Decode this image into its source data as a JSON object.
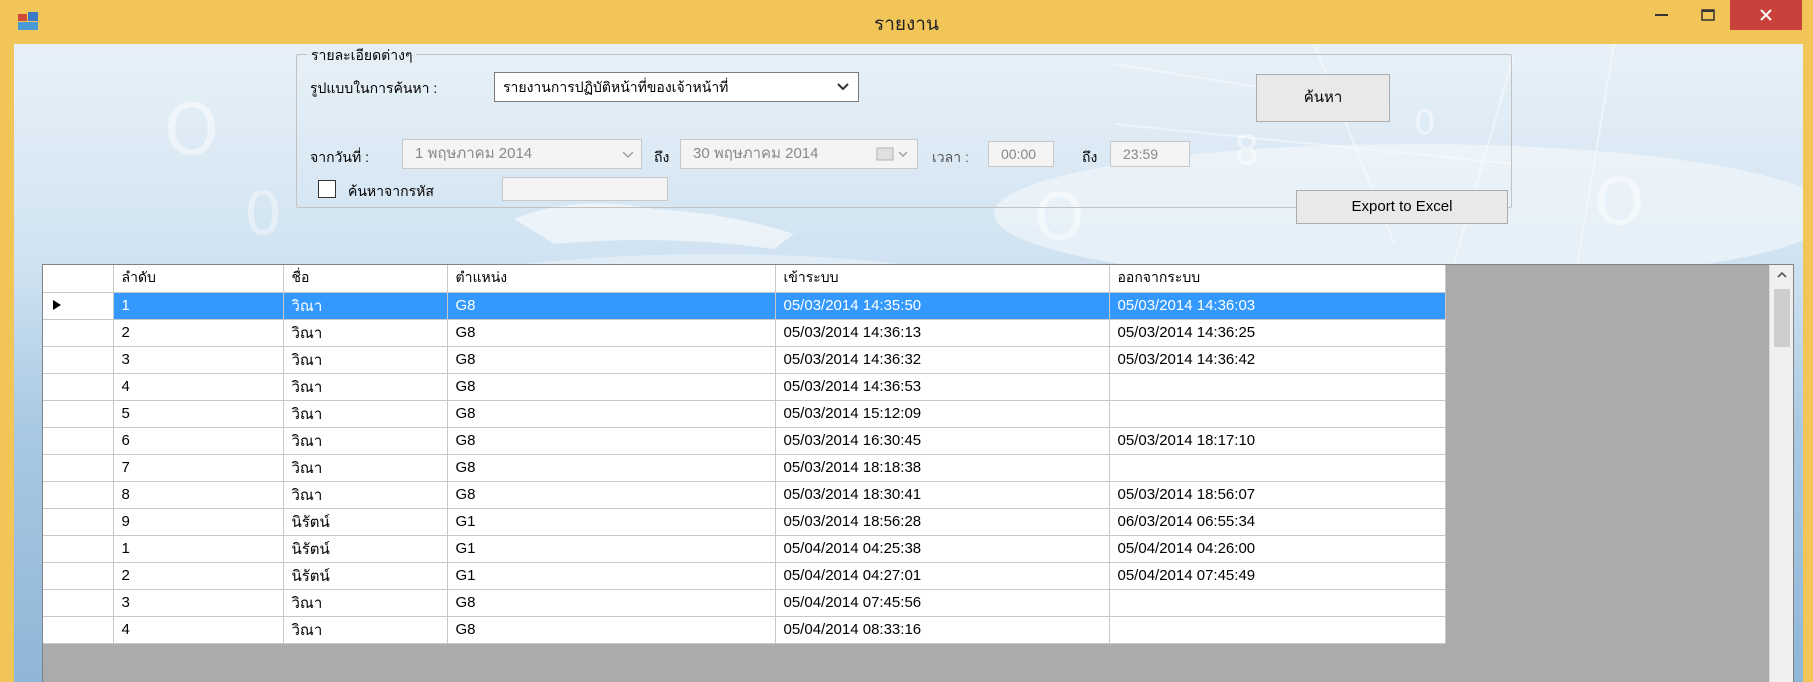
{
  "window": {
    "title": "รายงาน"
  },
  "filters": {
    "group_title": "รายละเอียดต่างๆ",
    "search_type_label": "รูปแบบในการค้นหา :",
    "search_type_value": "รายงานการปฏิบัติหน้าที่ของเจ้าหน้าที่",
    "from_date_label": "จากวันที่ :",
    "from_date_value": "1 พฤษภาคม 2014",
    "to_label": "ถึง",
    "to_date_value": "30 พฤษภาคม 2014",
    "time_label": "เวลา :",
    "time_from": "00:00",
    "time_to_label": "ถึง",
    "time_to": "23:59",
    "search_by_code_label": "ค้นหาจากรหัส",
    "search_by_code_checked": false,
    "code_value": ""
  },
  "buttons": {
    "search_label": "ค้นหา",
    "export_label": "Export to Excel"
  },
  "grid": {
    "columns": [
      "ลำดับ",
      "ชื่อ",
      "ตำแหน่ง",
      "เข้าระบบ",
      "ออกจากระบบ"
    ],
    "rows": [
      {
        "no": "1",
        "name": "วิณา",
        "position": "G8",
        "login": "05/03/2014 14:35:50",
        "logout": "05/03/2014 14:36:03"
      },
      {
        "no": "2",
        "name": "วิณา",
        "position": "G8",
        "login": "05/03/2014 14:36:13",
        "logout": "05/03/2014 14:36:25"
      },
      {
        "no": "3",
        "name": "วิณา",
        "position": "G8",
        "login": "05/03/2014 14:36:32",
        "logout": "05/03/2014 14:36:42"
      },
      {
        "no": "4",
        "name": "วิณา",
        "position": "G8",
        "login": "05/03/2014 14:36:53",
        "logout": ""
      },
      {
        "no": "5",
        "name": "วิณา",
        "position": "G8",
        "login": "05/03/2014 15:12:09",
        "logout": ""
      },
      {
        "no": "6",
        "name": "วิณา",
        "position": "G8",
        "login": "05/03/2014 16:30:45",
        "logout": "05/03/2014 18:17:10"
      },
      {
        "no": "7",
        "name": "วิณา",
        "position": "G8",
        "login": "05/03/2014 18:18:38",
        "logout": ""
      },
      {
        "no": "8",
        "name": "วิณา",
        "position": "G8",
        "login": "05/03/2014 18:30:41",
        "logout": "05/03/2014 18:56:07"
      },
      {
        "no": "9",
        "name": "นิรัตน์",
        "position": "G1",
        "login": "05/03/2014 18:56:28",
        "logout": "06/03/2014 06:55:34"
      },
      {
        "no": "1",
        "name": "นิรัตน์",
        "position": "G1",
        "login": "05/04/2014 04:25:38",
        "logout": "05/04/2014 04:26:00"
      },
      {
        "no": "2",
        "name": "นิรัตน์",
        "position": "G1",
        "login": "05/04/2014 04:27:01",
        "logout": "05/04/2014 07:45:49"
      },
      {
        "no": "3",
        "name": "วิณา",
        "position": "G8",
        "login": "05/04/2014 07:45:56",
        "logout": ""
      },
      {
        "no": "4",
        "name": "วิณา",
        "position": "G8",
        "login": "05/04/2014 08:33:16",
        "logout": ""
      }
    ],
    "selected_row": 0
  },
  "icons": {
    "app": "app-window-icon",
    "current_row": "row-pointer-icon",
    "dropdown": "chevron-down-icon",
    "scroll_up": "chevron-up-icon"
  },
  "colors": {
    "titlebar": "#f2c559",
    "close_button": "#c8413a",
    "selection": "#3399ff",
    "grid_empty_area": "#ababab"
  }
}
